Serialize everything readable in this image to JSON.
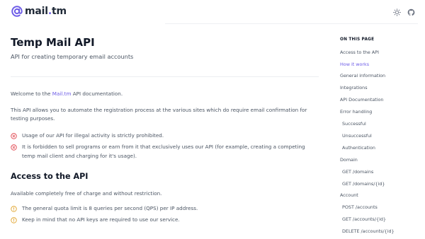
{
  "header": {
    "logo_prefix": "mail",
    "logo_dot": ".",
    "logo_suffix": "tm",
    "icons": [
      "sun-icon",
      "github-icon"
    ]
  },
  "main": {
    "title": "Temp Mail API",
    "subtitle": "API for creating temporary email accounts",
    "welcome_pre": "Welcome to the ",
    "welcome_link": "Mail.tm",
    "welcome_post": " API documentation.",
    "intro": "This API allows you to automate the registration process at the various sites which do require email confirmation for testing purposes.",
    "warnings": [
      "Usage of our API for illegal activity is strictly prohibited.",
      "It is forbidden to sell programs or earn from it that exclusively uses our API (for example, creating a competing temp mail client and charging for it's usage)."
    ],
    "access_heading": "Access to the API",
    "access_text": "Available completely free of charge and without restriction.",
    "notices": [
      "The general quota limit is 8 queries per second (QPS) per IP address.",
      "Keep in mind that no API keys are required to use our service."
    ]
  },
  "toc": {
    "title": "ON THIS PAGE",
    "items": [
      {
        "label": "Access to the API",
        "active": false,
        "sub": false
      },
      {
        "label": "How it works",
        "active": true,
        "sub": false
      },
      {
        "label": "General information",
        "active": false,
        "sub": false
      },
      {
        "label": "Integrations",
        "active": false,
        "sub": false
      },
      {
        "label": "API Documentation",
        "active": false,
        "sub": false
      },
      {
        "label": "Error handling",
        "active": false,
        "sub": false
      },
      {
        "label": "Successful",
        "active": false,
        "sub": true
      },
      {
        "label": "Unsuccessful",
        "active": false,
        "sub": true
      },
      {
        "label": "Authentication",
        "active": false,
        "sub": true
      },
      {
        "label": "Domain",
        "active": false,
        "sub": false
      },
      {
        "label": "GET /domains",
        "active": false,
        "sub": true
      },
      {
        "label": "GET /domains/{id}",
        "active": false,
        "sub": true
      },
      {
        "label": "Account",
        "active": false,
        "sub": false
      },
      {
        "label": "POST /accounts",
        "active": false,
        "sub": true
      },
      {
        "label": "GET /accounts/{id}",
        "active": false,
        "sub": true
      },
      {
        "label": "DELETE /accounts/{id}",
        "active": false,
        "sub": true
      }
    ]
  },
  "colors": {
    "accent": "#6d5ce7",
    "error": "#e0444d",
    "warning": "#e0a32b"
  }
}
